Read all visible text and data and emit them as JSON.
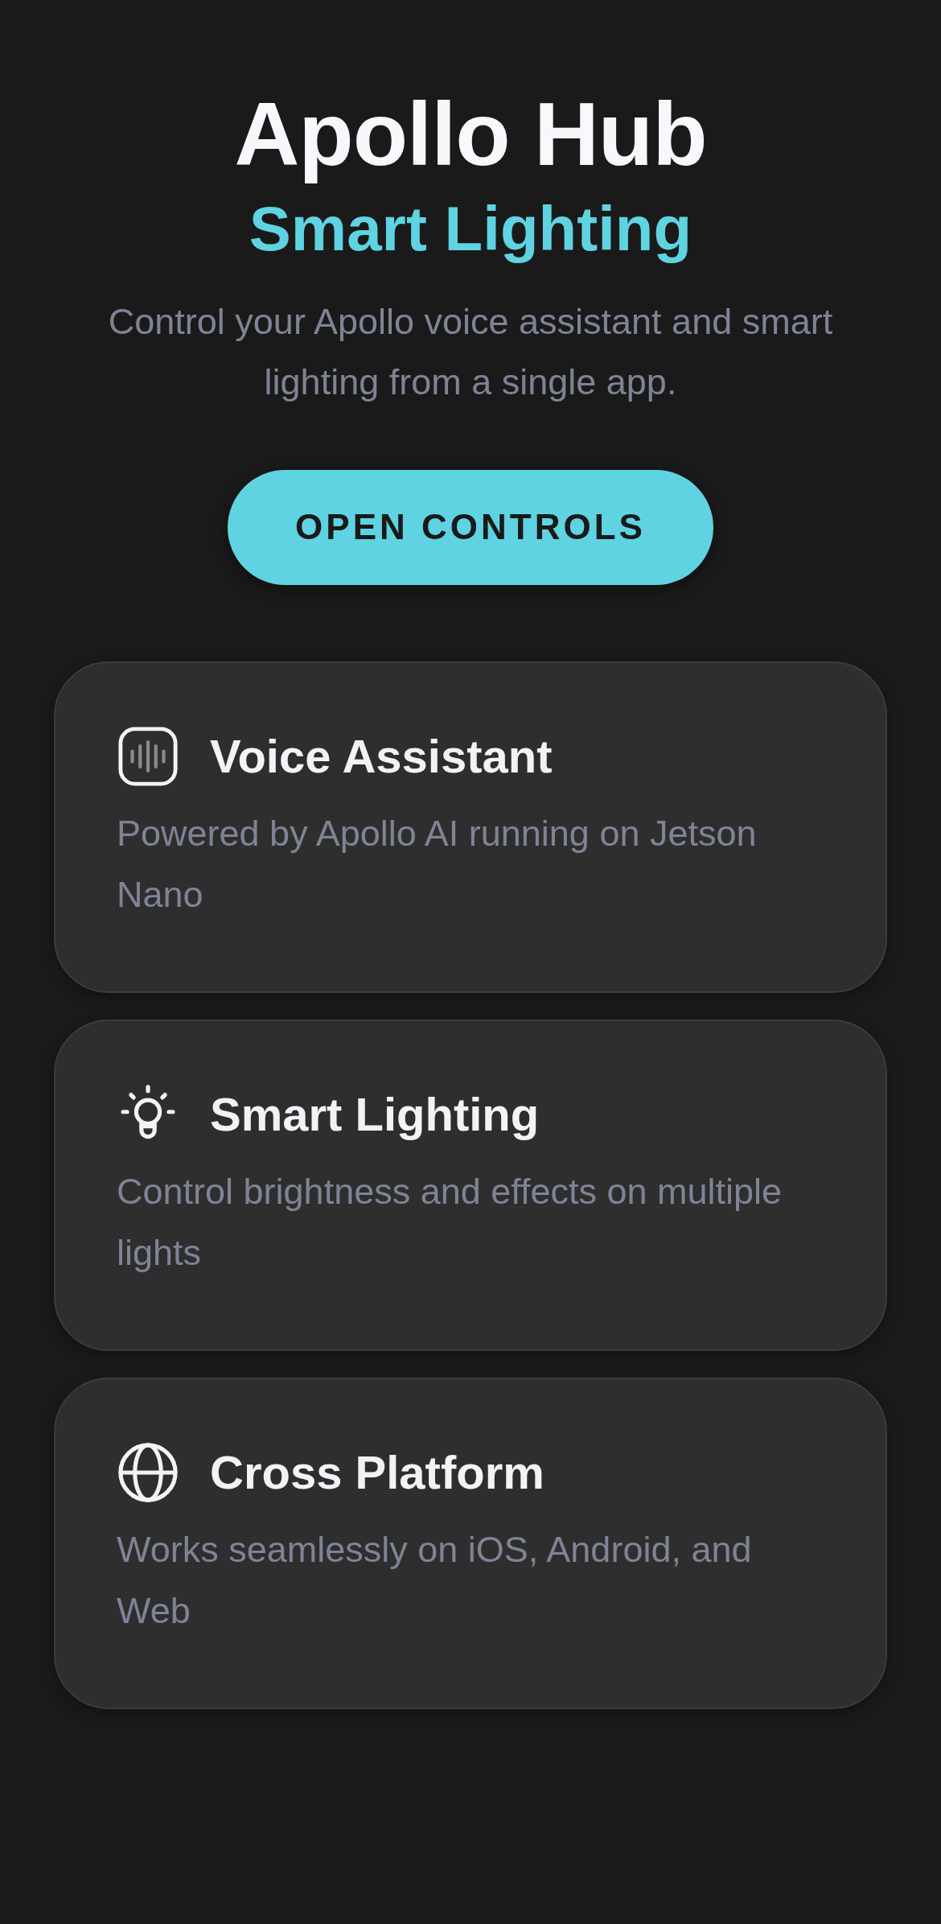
{
  "header": {
    "title": "Apollo Hub",
    "subtitle": "Smart Lighting",
    "description": "Control your Apollo voice assistant and smart lighting from a single app."
  },
  "primary_button": {
    "label": "OPEN CONTROLS"
  },
  "features": [
    {
      "kind": "waveform",
      "title": "Voice Assistant",
      "description": "Powered by Apollo AI running on Jetson Nano"
    },
    {
      "kind": "bulb",
      "title": "Smart Lighting",
      "description": "Control brightness and effects on multiple lights"
    },
    {
      "kind": "globe",
      "title": "Cross Platform",
      "description": "Works seamlessly on iOS, Android, and Web"
    }
  ]
}
